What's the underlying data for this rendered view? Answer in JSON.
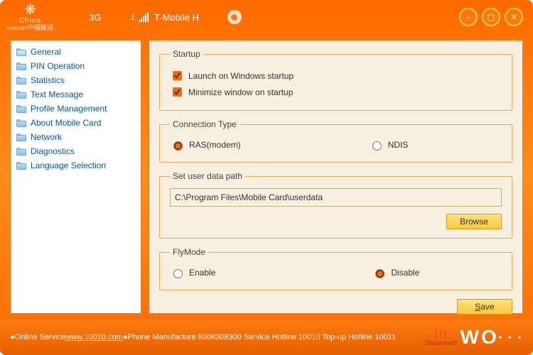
{
  "brand": {
    "line1": "China",
    "line2": "unicom中国联通"
  },
  "titlebar": {
    "mode": "3G",
    "carrier": "T-Mobile H"
  },
  "sidebar": {
    "items": [
      {
        "label": "General",
        "open": true
      },
      {
        "label": "PIN Operation"
      },
      {
        "label": "Statistics"
      },
      {
        "label": "Text Message"
      },
      {
        "label": "Profile Management"
      },
      {
        "label": "About Mobile Card"
      },
      {
        "label": "Network"
      },
      {
        "label": "Diagnostics"
      },
      {
        "label": "Language Selection"
      }
    ]
  },
  "groups": {
    "startup": {
      "legend": "Startup",
      "launch_label": "Launch on Windows startup",
      "minimize_label": "Minimize window on startup"
    },
    "connection": {
      "legend": "Connection Type",
      "ras_label": "RAS(modem)",
      "ndis_label": "NDIS"
    },
    "userdata": {
      "legend": "Set user data path",
      "path_value": "C:\\Program Files\\Mobile Card\\userdata",
      "browse_label": "Browse"
    },
    "flymode": {
      "legend": "FlyMode",
      "enable_label": "Enable",
      "disable_label": "Disable"
    }
  },
  "buttons": {
    "save_prefix": "S",
    "save_rest": "ave"
  },
  "footer": {
    "online_prefix": "Online Service ",
    "online_url": "www.10010.com",
    "rest": " ●Phone Manufacture 8008308300 Service Hotline 10010 Top-up Hotline 10011",
    "bullet": "●",
    "disconnect": "Disconnect"
  }
}
